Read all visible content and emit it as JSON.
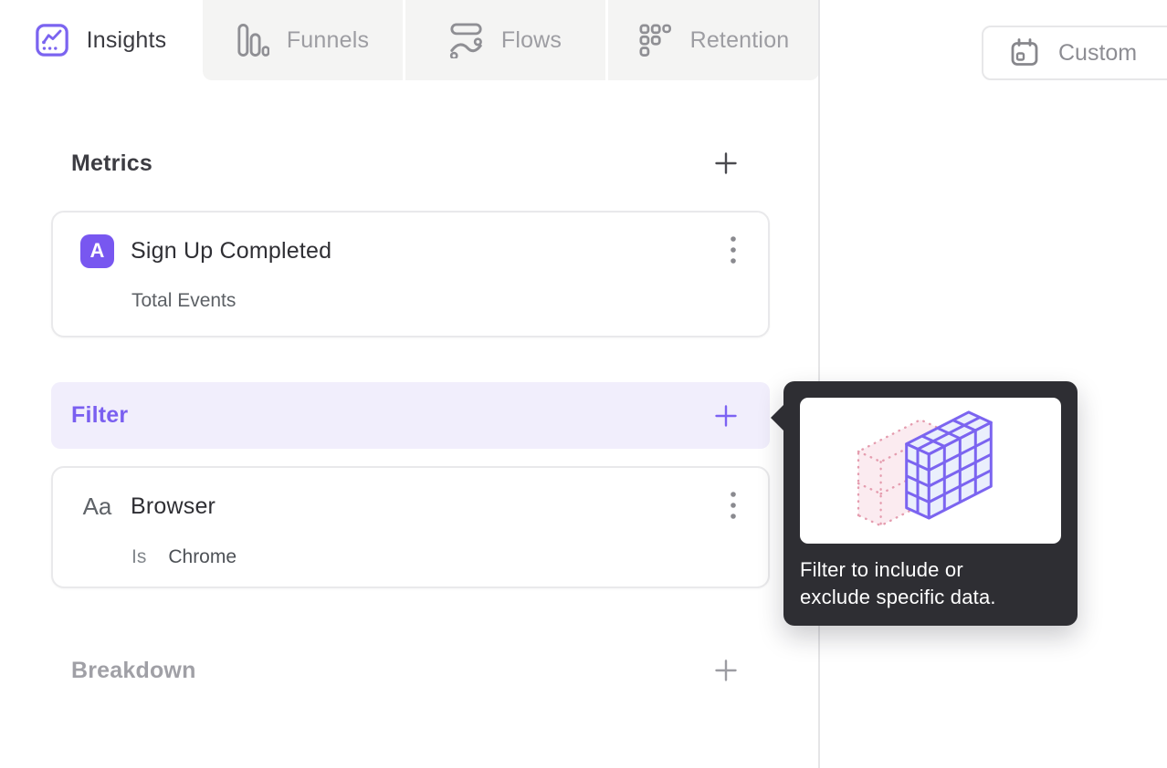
{
  "tabs": [
    {
      "label": "Insights",
      "active": true
    },
    {
      "label": "Funnels",
      "active": false
    },
    {
      "label": "Flows",
      "active": false
    },
    {
      "label": "Retention",
      "active": false
    }
  ],
  "date_picker": {
    "label": "Custom"
  },
  "sections": {
    "metrics": {
      "title": "Metrics"
    },
    "filter": {
      "title": "Filter"
    },
    "breakdown": {
      "title": "Breakdown"
    }
  },
  "metric_card": {
    "badge": "A",
    "title": "Sign Up Completed",
    "subtitle": "Total Events"
  },
  "filter_card": {
    "badge": "Aa",
    "title": "Browser",
    "operator": "Is",
    "value": "Chrome"
  },
  "tooltip": {
    "lines": [
      "Filter to include or",
      "exclude specific data."
    ]
  },
  "colors": {
    "accent_purple": "#7c62f3",
    "badge_purple": "#7857f0",
    "filter_row_bg": "#f1eefc",
    "tooltip_bg": "#2e2e33",
    "inactive_tab_bg": "#f4f4f3",
    "cube_stroke": "#7b64f0",
    "cube_fill": "#eaeffc",
    "pink_stroke": "#e59daf",
    "pink_fill": "#fbe9ee"
  }
}
